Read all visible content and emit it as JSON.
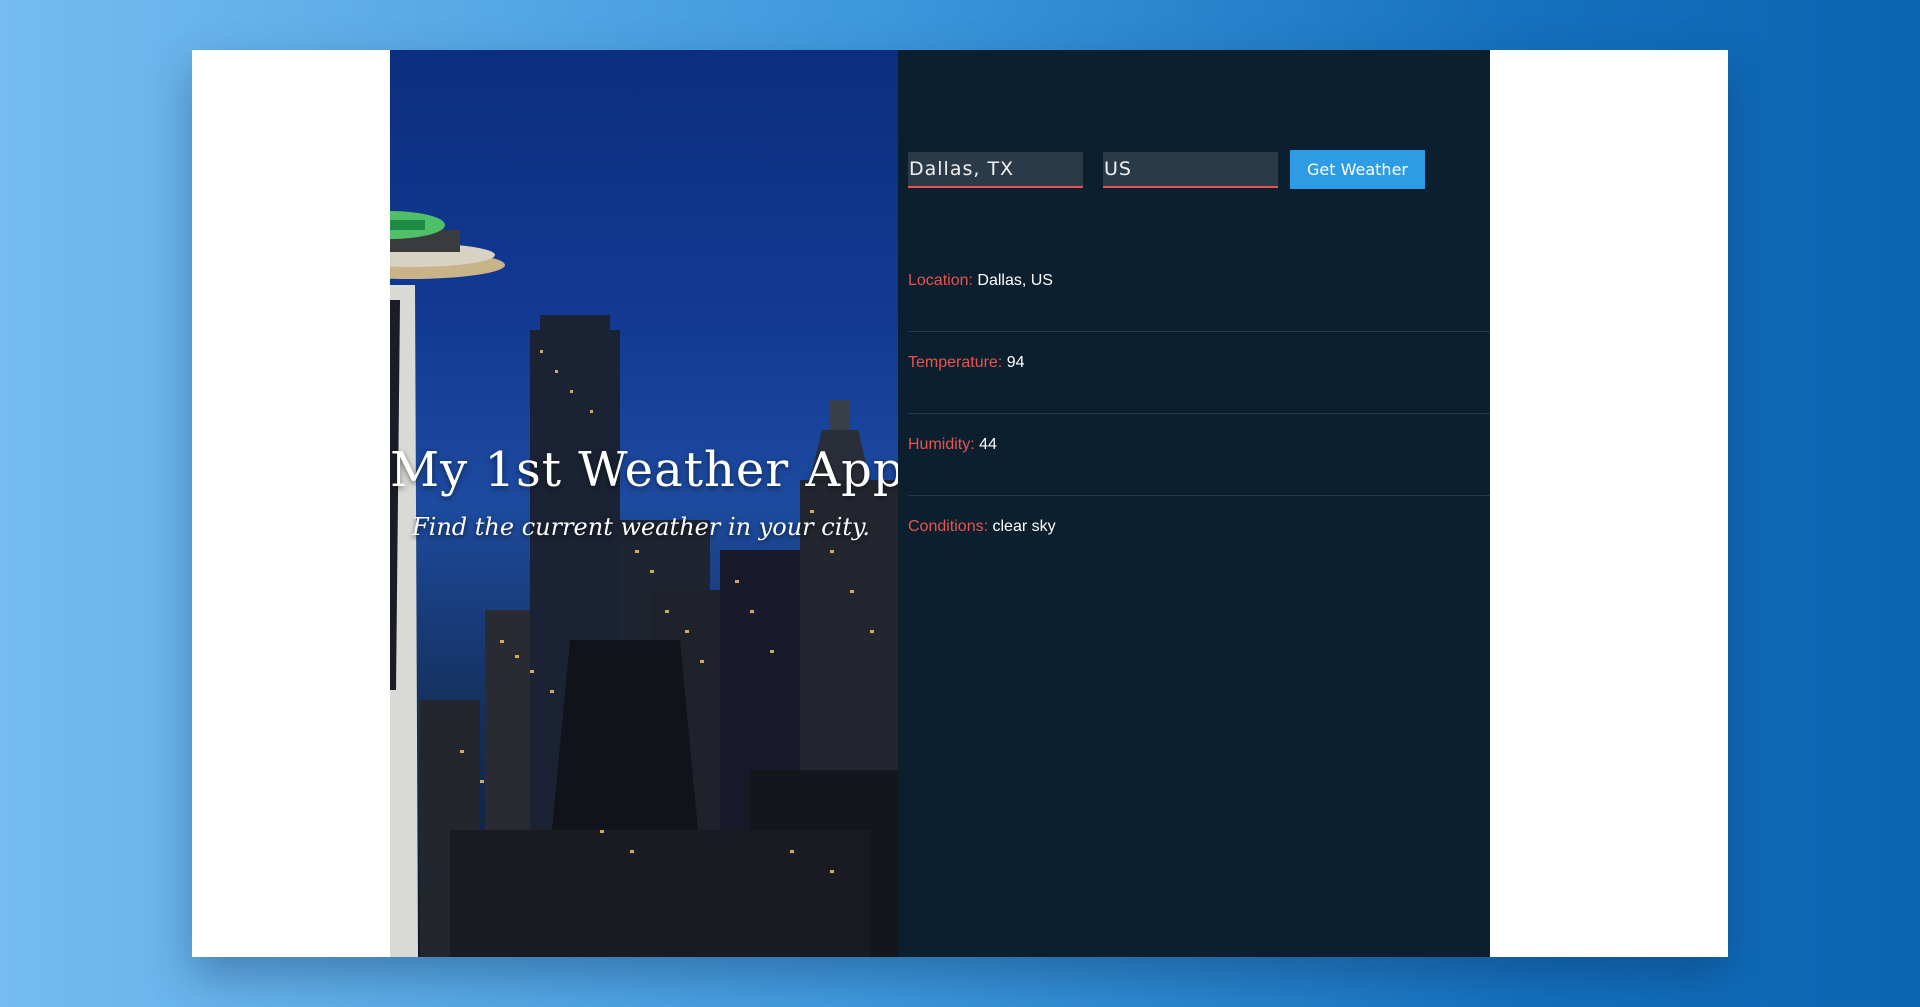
{
  "hero": {
    "title": "My 1st Weather App",
    "subtitle": "Find the current weather in your city."
  },
  "form": {
    "city_value": "Dallas, TX",
    "country_value": "US",
    "button_label": "Get Weather"
  },
  "results": [
    {
      "label": "Location:",
      "value": "Dallas, US"
    },
    {
      "label": "Temperature:",
      "value": "94"
    },
    {
      "label": "Humidity:",
      "value": "44"
    },
    {
      "label": "Conditions:",
      "value": "clear sky"
    }
  ],
  "colors": {
    "accent": "#e8534f",
    "button": "#2e9ce4",
    "panel": "#0c1f2e"
  }
}
